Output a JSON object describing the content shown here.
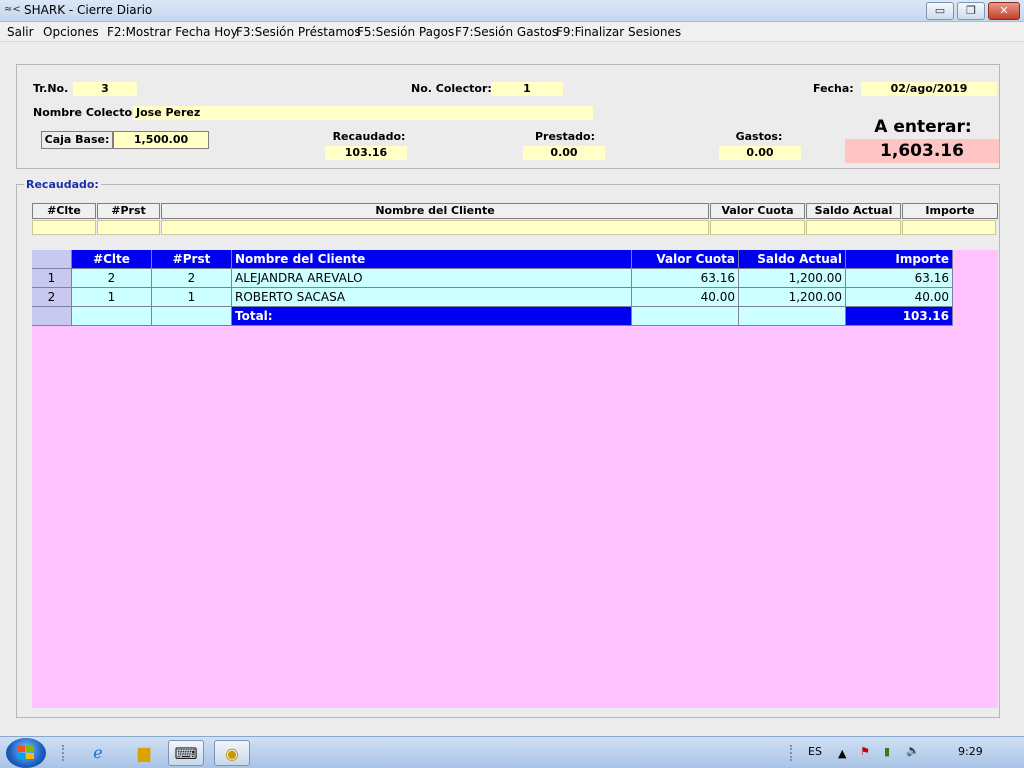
{
  "window": {
    "title": "SHARK - Cierre Diario",
    "min_glyph": "▭",
    "max_glyph": "❐",
    "close_glyph": "✕",
    "app_icon": "shark-app-icon"
  },
  "menu": [
    "Salir",
    "Opciones",
    "F2:Mostrar Fecha Hoy",
    "F3:Sesión Préstamos",
    "F5:Sesión Pagos",
    "F7:Sesión Gastos",
    "F9:Finalizar Sesiones"
  ],
  "header": {
    "trno_label": "Tr.No.",
    "trno_value": "3",
    "colector_label": "No. Colector:",
    "colector_value": "1",
    "fecha_label": "Fecha:",
    "fecha_value": "02/ago/2019",
    "nombre_label": "Nombre Colector:",
    "nombre_value": "Jose Perez",
    "caja_label": "Caja Base:",
    "caja_value": "1,500.00",
    "recaudado_label": "Recaudado:",
    "recaudado_value": "103.16",
    "prestado_label": "Prestado:",
    "prestado_value": "0.00",
    "gastos_label": "Gastos:",
    "gastos_value": "0.00",
    "enterar_label": "A enterar:",
    "enterar_value": "1,603.16"
  },
  "group_title": "Recaudado:",
  "input_grid": {
    "headers": [
      "#Clte",
      "#Prst",
      "Nombre del Cliente",
      "Valor Cuota",
      "Saldo Actual",
      "Importe"
    ]
  },
  "results": {
    "headers": [
      "#Clte",
      "#Prst",
      "Nombre del Cliente",
      "Valor Cuota",
      "Saldo Actual",
      "Importe"
    ],
    "rows": [
      {
        "index": "1",
        "clte": "2",
        "prst": "2",
        "nombre": "ALEJANDRA AREVALO",
        "cuota": "63.16",
        "saldo": "1,200.00",
        "importe": "63.16"
      },
      {
        "index": "2",
        "clte": "1",
        "prst": "1",
        "nombre": "ROBERTO SACASA",
        "cuota": "40.00",
        "saldo": "1,200.00",
        "importe": "40.00"
      }
    ],
    "total_label": "Total:",
    "total_value": "103.16"
  },
  "taskbar": {
    "language": "ES",
    "clock": "9:29",
    "icons": [
      "ie-icon",
      "explorer-icon",
      "shark-app-icon",
      "norton-icon"
    ]
  }
}
